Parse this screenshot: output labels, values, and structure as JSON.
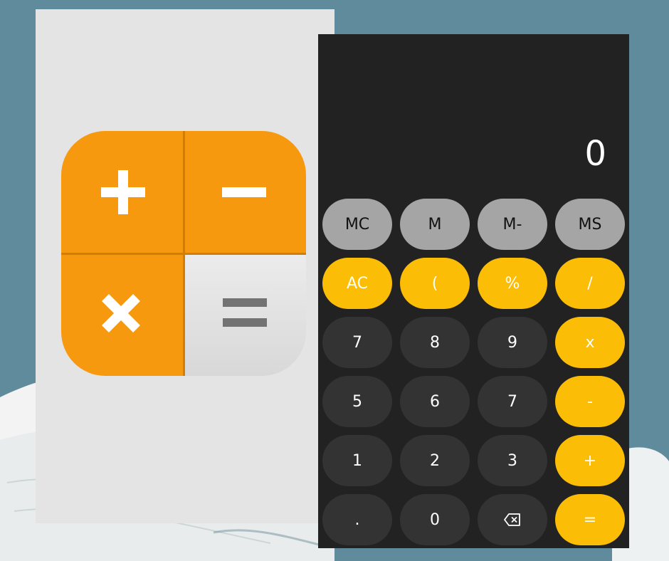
{
  "display": {
    "value": "0"
  },
  "memory_row": [
    "MC",
    "M",
    "M-",
    "MS"
  ],
  "function_row": [
    "AC",
    "(",
    "%",
    "/"
  ],
  "number_rows": [
    [
      "7",
      "8",
      "9",
      "x"
    ],
    [
      "5",
      "6",
      "7",
      "-"
    ],
    [
      "1",
      "2",
      "3",
      "+"
    ],
    [
      ".",
      "0",
      "",
      "="
    ]
  ],
  "icon_names": {
    "plus": "plus-icon",
    "minus": "minus-icon",
    "times": "multiply-icon",
    "equals": "equals-icon",
    "backspace": "backspace-icon"
  },
  "colors": {
    "background": "#5f8b9c",
    "icon_orange": "#f7990f",
    "phone_bg": "#222222",
    "memory_key": "#a5a5a5",
    "accent_key": "#fcbd06",
    "number_key": "#333333"
  }
}
